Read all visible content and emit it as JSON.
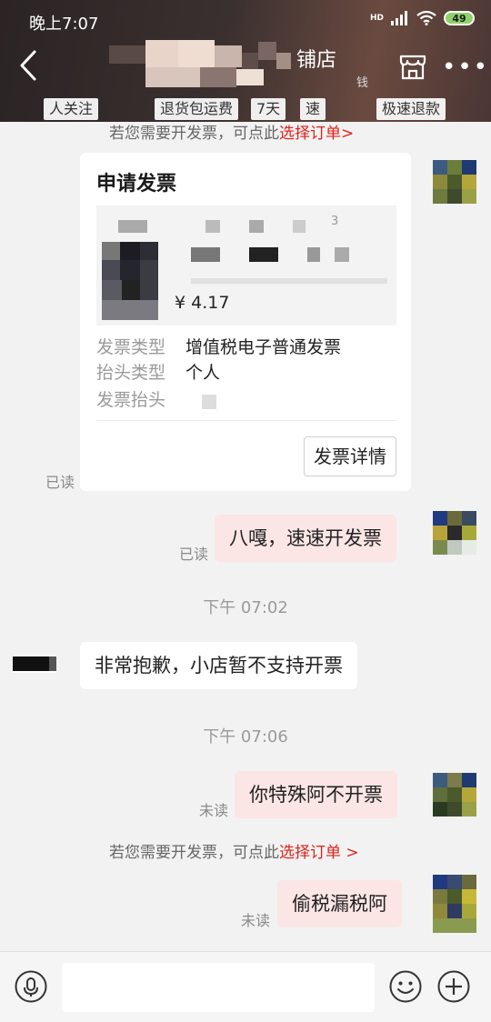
{
  "status_bar": {
    "time": "晚上7:07",
    "network": "HD",
    "battery": "49"
  },
  "header": {
    "title_visible": "铺店",
    "subtitle_visible": "钱",
    "tags": [
      "人关注",
      "退货包运费",
      "7天",
      "速",
      "极速退款"
    ]
  },
  "system_notice": {
    "prefix": "若您需要开发票，可点此",
    "link": "选择订单",
    "arrow": ">"
  },
  "invoice_card": {
    "title": "申请发票",
    "price": "¥ 4.17",
    "price_suffix": "3",
    "rows": [
      {
        "key": "发票类型",
        "value": "增值税电子普通发票"
      },
      {
        "key": "抬头类型",
        "value": "个人"
      },
      {
        "key": "发票抬头",
        "value": ""
      }
    ],
    "button": "发票详情",
    "read_status": "已读"
  },
  "messages": [
    {
      "side": "right",
      "text": "八嘎，速速开发票",
      "status": "已读"
    },
    {
      "type": "time",
      "text": "下午 07:02"
    },
    {
      "side": "left",
      "text": "非常抱歉，小店暂不支持开票"
    },
    {
      "type": "time",
      "text": "下午 07:06"
    },
    {
      "side": "right",
      "text": "你特殊阿不开票",
      "status": "未读"
    },
    {
      "type": "notice",
      "text": "若您需要开发票，可点此",
      "link": "选择订单 >"
    },
    {
      "side": "right",
      "text": "偷税漏税阿",
      "status": "未读"
    }
  ],
  "input_bar": {
    "placeholder": ""
  },
  "colors": {
    "link_red": "#e0221a",
    "bubble_right": "#fbe5e5",
    "header_dark": "#2b2424"
  }
}
